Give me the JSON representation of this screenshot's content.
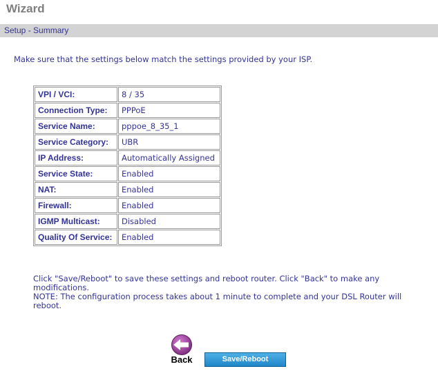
{
  "header": {
    "title": "Wizard"
  },
  "section": {
    "label": "Setup - Summary"
  },
  "intro": "Make sure that the settings below match the settings provided by your ISP.",
  "summary": [
    {
      "key": "VPI / VCI:",
      "value": "8 / 35"
    },
    {
      "key": "Connection Type:",
      "value": "PPPoE"
    },
    {
      "key": "Service Name:",
      "value": "pppoe_8_35_1"
    },
    {
      "key": "Service Category:",
      "value": "UBR"
    },
    {
      "key": "IP Address:",
      "value": "Automatically Assigned"
    },
    {
      "key": "Service State:",
      "value": "Enabled"
    },
    {
      "key": "NAT:",
      "value": "Enabled"
    },
    {
      "key": "Firewall:",
      "value": "Enabled"
    },
    {
      "key": "IGMP Multicast:",
      "value": "Disabled"
    },
    {
      "key": "Quality Of Service:",
      "value": "Enabled"
    }
  ],
  "notes": {
    "line1": "Click \"Save/Reboot\" to save these settings and reboot router. Click \"Back\" to make any modifications.",
    "line2": "NOTE: The configuration process takes about 1 minute to complete and your DSL Router will reboot."
  },
  "buttons": {
    "back_label": "Back",
    "save_label": "Save/Reboot",
    "back_icon": "back-arrow-icon"
  },
  "colors": {
    "text": "#333399",
    "title": "#7f7f7f",
    "bar": "#d3d3d3",
    "button": "#1f86c9",
    "back_icon": "#993399"
  }
}
